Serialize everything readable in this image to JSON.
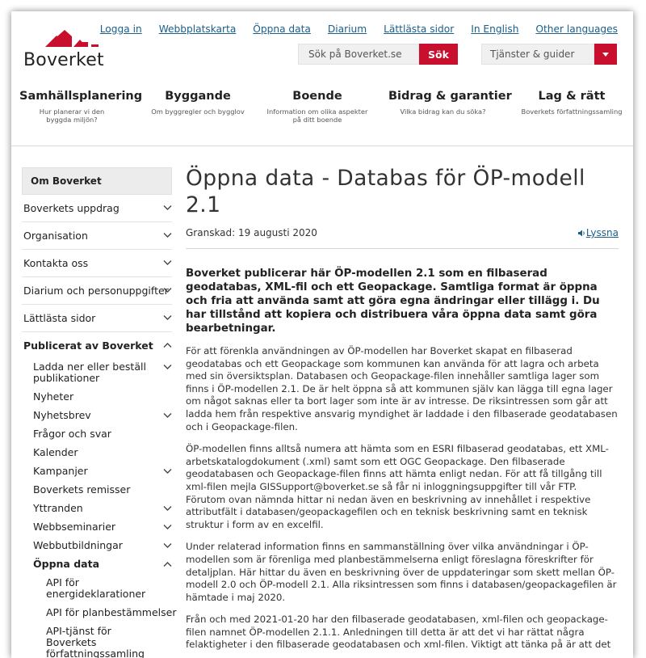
{
  "brand": {
    "name": "Boverket",
    "color": "#c8102e"
  },
  "top_links": [
    "Logga in",
    "Webbplatskarta",
    "Öppna data",
    "Diarium",
    "Lättlästa sidor",
    "In English",
    "Other languages"
  ],
  "search": {
    "placeholder": "Sök på Boverket.se",
    "button": "Sök"
  },
  "guides": {
    "label": "Tjänster & guider"
  },
  "main_nav": [
    {
      "title": "Samhällsplanering",
      "desc": "Hur planerar vi den byggda miljön?"
    },
    {
      "title": "Byggande",
      "desc": "Om byggregler och bygglov"
    },
    {
      "title": "Boende",
      "desc": "Information om olika aspekter på ditt boende"
    },
    {
      "title": "Bidrag & garantier",
      "desc": "Vilka bidrag kan du söka?"
    },
    {
      "title": "Lag & rätt",
      "desc": "Boverkets författningssamling"
    }
  ],
  "sidebar": {
    "heading": "Om Boverket",
    "items": [
      "Boverkets uppdrag",
      "Organisation",
      "Kontakta oss",
      "Diarium och personuppgifter",
      "Lättlästa sidor",
      "Publicerat av Boverket"
    ],
    "sub_items": [
      "Ladda ner eller beställ publikationer",
      "Nyheter",
      "Nyhetsbrev",
      "Frågor och svar",
      "Kalender",
      "Kampanjer",
      "Boverkets remisser",
      "Yttranden",
      "Webbseminarier",
      "Webbutbildningar",
      "Öppna data"
    ],
    "subsub_items": [
      "API för energideklarationer",
      "API för planbestämmelser",
      "API-tjänst för Boverkets författningssamling"
    ]
  },
  "article": {
    "title": "Öppna data - Databas för ÖP-modell 2.1",
    "reviewed": "Granskad: 19 augusti 2020",
    "listen": "Lyssna",
    "lead": "Boverket publicerar här ÖP-modellen 2.1 som en filbaserad geodatabas, XML-fil och ett Geopackage. Samtliga format är öppna och fria att använda samt att göra egna ändringar eller tillägg i. Du har tillstånd att kopiera och distribuera våra öppna data samt göra bearbetningar.",
    "paragraphs": [
      "För att förenkla användningen av ÖP-modellen har Boverket skapat en filbaserad geodatabas och ett Geopackage som kommunen kan använda för att lagra och arbeta med sin översiktsplan. Databasen och Geopackage-filen innehåller samtliga lager som finns i ÖP-modellen 2.1.  De är helt öppna så att kommunen själv kan lägga till egna lager om något saknas eller ta bort lager som inte är av intresse. De riksintressen som går att ladda hem från respektive ansvarig myndighet är laddade i den filbaserade geodatabasen och i Geopackage-filen.",
      "ÖP-modellen finns alltså numera att hämta som en ESRI filbaserad geodatabas, ett XML-arbetskatalogdokument (.xml) samt som ett OGC Geopackage. Den filbaserade geodatabasen och Geopackage-filen finns att hämta enligt nedan. För att få tillgång till xml-filen mejla GISSupport@boverket.se så får ni inloggningsuppgifter till vår FTP. Förutom ovan nämnda hittar ni nedan även en beskrivning av innehållet i respektive attributfält i databasen/geopackagefilen och en teknisk beskrivning samt en teknisk struktur i form av en excelfil.",
      "Under relaterad information finns en sammanställning över vilka användningar i ÖP-modellen som är förenliga med planbestämmelserna enligt föreslagna föreskrifter för detaljplan. Här hittar du även en beskrivning över de uppdateringar som skett mellan ÖP-modell 2.0 och ÖP-modell 2.1. Alla riksintressen som finns i databasen/geopackagefilen är hämtade i maj 2020.",
      "Från och med 2021-01-20 har den filbaserade geodatabasen, xml-filen och geopackage-filen namnet ÖP-modellen 2.1.1. Anledningen till detta är att det vi har rättat några felaktigheter i den filbaserade geodatabasen och xml-filen. Viktigt att tänka på är att det"
    ]
  }
}
